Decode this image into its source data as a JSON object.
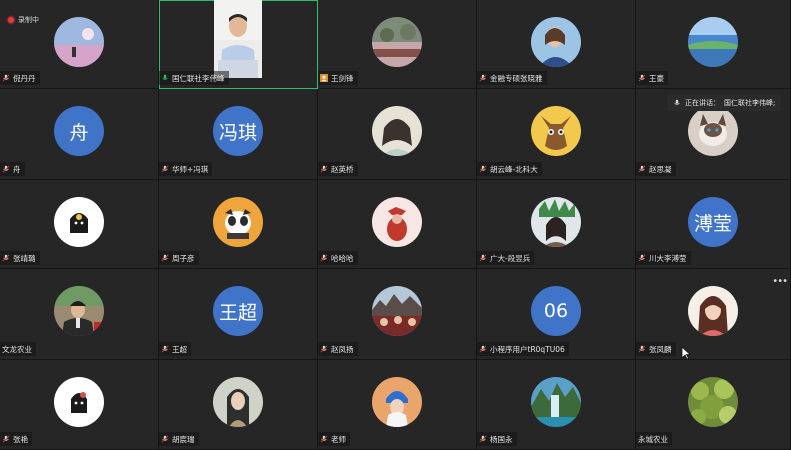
{
  "recording": {
    "label": "录制中"
  },
  "speaking_banner": {
    "label": "正在讲话：",
    "speaker": "国仁联社李伟峰;"
  },
  "more_icon": "more-horizontal-icon",
  "tiles": [
    {
      "name": "倪丹丹",
      "avatar_type": "image"
    },
    {
      "name": "国仁联社李伟峰",
      "avatar_type": "video",
      "active": true,
      "mic": "speaking"
    },
    {
      "name": "王剑锋",
      "avatar_type": "image",
      "badge": "host-icon"
    },
    {
      "name": "金融专硕张晓雅",
      "avatar_type": "image"
    },
    {
      "name": "王豪",
      "avatar_type": "image"
    },
    {
      "name": "舟",
      "avatar_type": "letter",
      "avatar_text": "舟"
    },
    {
      "name": "华师+冯琪",
      "avatar_type": "letter",
      "avatar_text": "冯琪"
    },
    {
      "name": "赵英桥",
      "avatar_type": "image"
    },
    {
      "name": "胡云峰-北科大",
      "avatar_type": "image"
    },
    {
      "name": "赵思凝",
      "avatar_type": "image"
    },
    {
      "name": "张靖璐",
      "avatar_type": "image"
    },
    {
      "name": "周子彦",
      "avatar_type": "image"
    },
    {
      "name": "哈哈哈",
      "avatar_type": "image"
    },
    {
      "name": "广大-段昱兵",
      "avatar_type": "image"
    },
    {
      "name": "川大李溥莹",
      "avatar_type": "letter",
      "avatar_text": "溥莹"
    },
    {
      "name": "文龙农业",
      "avatar_type": "image"
    },
    {
      "name": "王超",
      "avatar_type": "letter",
      "avatar_text": "王超"
    },
    {
      "name": "赵凤扬",
      "avatar_type": "image"
    },
    {
      "name": "小程序用户tR0qTU06",
      "avatar_type": "letter",
      "avatar_text": "06"
    },
    {
      "name": "张凤麟",
      "avatar_type": "image"
    },
    {
      "name": "张艳",
      "avatar_type": "image"
    },
    {
      "name": "胡宸瑞",
      "avatar_type": "image"
    },
    {
      "name": "老师",
      "avatar_type": "image"
    },
    {
      "name": "杨国永",
      "avatar_type": "image"
    },
    {
      "name": "永城农业",
      "avatar_type": "image"
    }
  ]
}
